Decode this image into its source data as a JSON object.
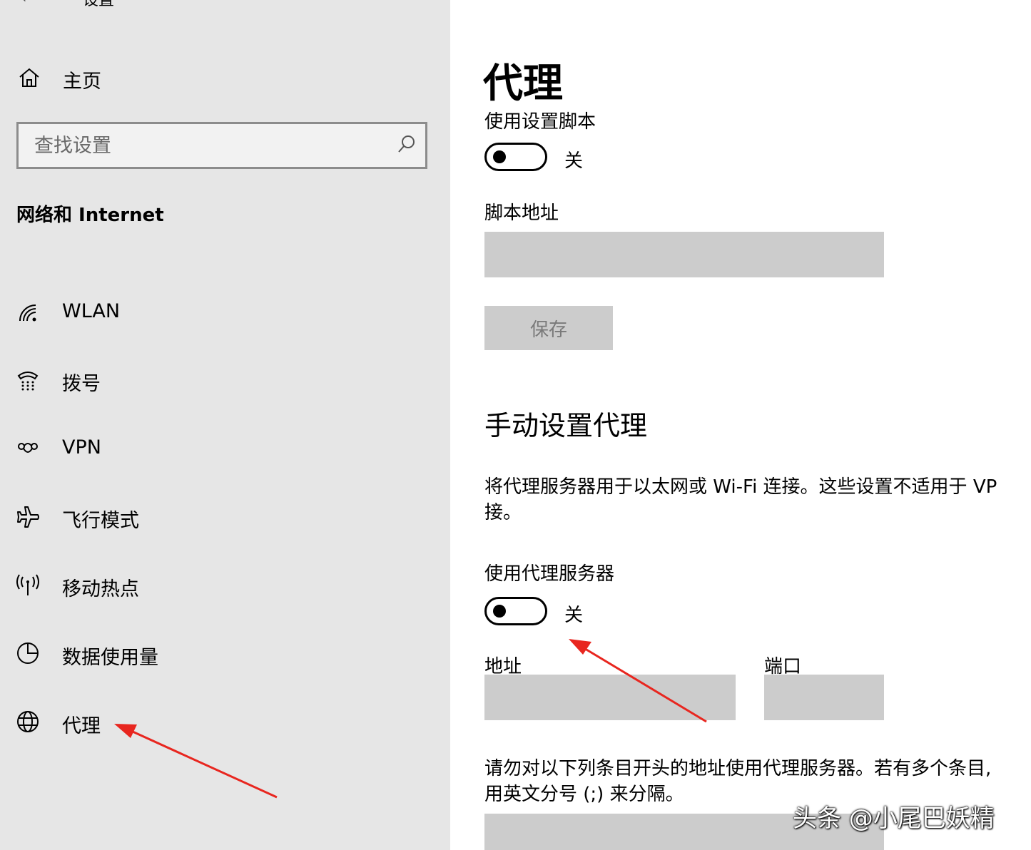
{
  "window": {
    "title": "设置"
  },
  "sidebar": {
    "home_label": "主页",
    "search": {
      "placeholder": "查找设置"
    },
    "section_title": "网络和 Internet",
    "items": [
      {
        "label": "WLAN",
        "icon": "wifi-icon"
      },
      {
        "label": "拨号",
        "icon": "dialup-icon"
      },
      {
        "label": "VPN",
        "icon": "vpn-icon"
      },
      {
        "label": "飞行模式",
        "icon": "airplane-icon"
      },
      {
        "label": "移动热点",
        "icon": "hotspot-icon"
      },
      {
        "label": "数据使用量",
        "icon": "data-usage-icon"
      },
      {
        "label": "代理",
        "icon": "globe-icon"
      }
    ]
  },
  "main": {
    "page_title": "代理",
    "script_setting_label": "使用设置脚本",
    "script_toggle_state": "关",
    "script_address_label": "脚本地址",
    "save_button": "保存",
    "manual_section_title": "手动设置代理",
    "manual_desc_line1": "将代理服务器用于以太网或 Wi-Fi 连接。这些设置不适用于 VP",
    "manual_desc_line2": "接。",
    "use_proxy_label": "使用代理服务器",
    "proxy_toggle_state": "关",
    "address_label": "地址",
    "port_label": "端口",
    "exceptions_line1": "请勿对以下列条目开头的地址使用代理服务器。若有多个条目,",
    "exceptions_line2": "用英文分号 (;) 来分隔。"
  },
  "watermark": "头条 @小尾巴妖精",
  "colors": {
    "sidebar_bg": "#e6e6e6",
    "field_bg": "#cccccc",
    "annotation_arrow": "#e8261f"
  }
}
